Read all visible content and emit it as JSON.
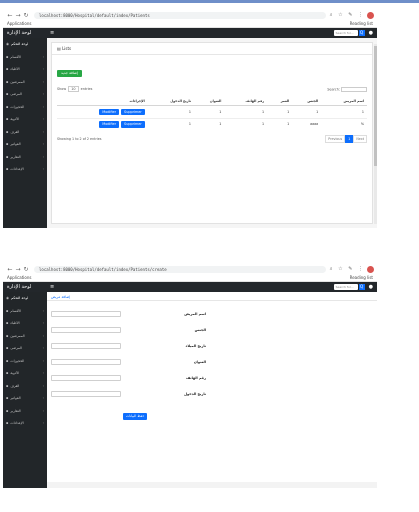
{
  "screen1": {
    "browser": {
      "url": "localhost:8000/Hospital/default/index/Patients",
      "bookmarks": "Applications",
      "reading_list": "Reading list"
    },
    "app": {
      "brand": "لوحة الإدارة",
      "search_placeholder": "Search for...",
      "search_btn": "Q"
    },
    "sidebar": [
      {
        "label": "لوحة التحكم",
        "icon": "speedometer-icon"
      },
      {
        "label": "الأقسام",
        "icon": "folder-icon"
      },
      {
        "label": "الأطباء",
        "icon": "doctor-icon"
      },
      {
        "label": "الممرضين",
        "icon": "nurse-icon"
      },
      {
        "label": "المرضى",
        "icon": "patient-icon"
      },
      {
        "label": "الحجوزات",
        "icon": "calendar-icon"
      },
      {
        "label": "الأدوية",
        "icon": "pill-icon"
      },
      {
        "label": "الغرف",
        "icon": "bed-icon"
      },
      {
        "label": "الفواتير",
        "icon": "invoice-icon"
      },
      {
        "label": "التقارير",
        "icon": "report-icon"
      },
      {
        "label": "الإعدادات",
        "icon": "gear-icon"
      }
    ],
    "card_title": "Lists",
    "add_button": "إضافة جديد",
    "show": "Show",
    "entries": "entries",
    "entries_value": "10",
    "search_label": "Search:",
    "columns": [
      "اسم المريض",
      "الجنس",
      "العمر",
      "رقم الهاتف",
      "العنوان",
      "تاريخ الدخول",
      "الإجراءات"
    ],
    "rows": [
      {
        "name": "1",
        "gender": "1",
        "age": "1",
        "phone": "1",
        "address": "1",
        "date": "1",
        "edit": "Modifier",
        "delete": "Supprimer"
      },
      {
        "name": "%",
        "gender": "aaaa",
        "age": "1",
        "phone": "1",
        "address": "1",
        "date": "1",
        "edit": "Modifier",
        "delete": "Supprimer"
      }
    ],
    "showing": "Showing 1 to 2 of 2 entries",
    "previous": "Previous",
    "page": "1",
    "next": "Next"
  },
  "screen2": {
    "browser": {
      "url": "localhost:8000/Hospital/default/index/Patients/create",
      "bookmarks": "Applications",
      "reading_list": "Reading list"
    },
    "app": {
      "brand": "لوحة الإدارة",
      "search_placeholder": "Search for...",
      "search_btn": "Q"
    },
    "tab": "إضافة مريض",
    "fields": [
      "اسم المريض",
      "الجنس",
      "تاريخ الميلاد",
      "العنوان",
      "رقم الهاتف",
      "تاريخ الدخول"
    ],
    "submit": "حفظ البيانات"
  }
}
